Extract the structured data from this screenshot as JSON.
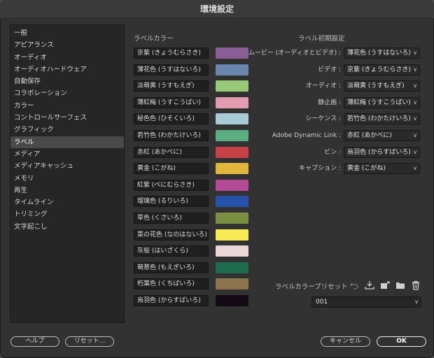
{
  "window": {
    "title": "環境設定"
  },
  "sidebar": {
    "items": [
      {
        "label": "一般"
      },
      {
        "label": "アピアランス"
      },
      {
        "label": "オーディオ"
      },
      {
        "label": "オーディオハードウェア"
      },
      {
        "label": "自動保存"
      },
      {
        "label": "コラボレーション"
      },
      {
        "label": "カラー"
      },
      {
        "label": "コントロールサーフェス"
      },
      {
        "label": "グラフィック"
      },
      {
        "label": "ラベル",
        "selected": true
      },
      {
        "label": "メディア"
      },
      {
        "label": "メディアキャッシュ"
      },
      {
        "label": "メモリ"
      },
      {
        "label": "再生"
      },
      {
        "label": "タイムライン"
      },
      {
        "label": "トリミング"
      },
      {
        "label": "文字起こし"
      }
    ]
  },
  "label_colors": {
    "title": "ラベルカラー",
    "items": [
      {
        "name": "京紫 (きょうむらさき)",
        "color": "#8a5f95"
      },
      {
        "name": "薄花色 (うすはないろ)",
        "color": "#6b86ad"
      },
      {
        "name": "淡萌黄 (うすもえぎ)",
        "color": "#98c979"
      },
      {
        "name": "薄紅梅 (うすこうばい)",
        "color": "#e39bb2"
      },
      {
        "name": "秘色色 (ひそくいろ)",
        "color": "#a9cbd7"
      },
      {
        "name": "若竹色 (わかたけいろ)",
        "color": "#5aae82"
      },
      {
        "name": "赤紅 (あかべに)",
        "color": "#c84148"
      },
      {
        "name": "黄金 (こがね)",
        "color": "#e2b53d"
      },
      {
        "name": "紅紫 (べにむらさき)",
        "color": "#b34b97"
      },
      {
        "name": "瑠璃色 (るりいろ)",
        "color": "#2752ac"
      },
      {
        "name": "草色 (くさいろ)",
        "color": "#7b8e42"
      },
      {
        "name": "菜の花色 (なのはないろ)",
        "color": "#f7ea55"
      },
      {
        "name": "灰桜 (はいざくら)",
        "color": "#ead6d6"
      },
      {
        "name": "萌葱色 (もえぎいろ)",
        "color": "#1f6b4d"
      },
      {
        "name": "朽葉色 (くちばいろ)",
        "color": "#8d744d"
      },
      {
        "name": "烏羽色 (からすばいろ)",
        "color": "#140a16"
      }
    ]
  },
  "label_defaults": {
    "title": "ラベル初期設定",
    "items": [
      {
        "label": "ムービー (オーディオとビデオ) :",
        "value": "薄花色 (うすはないろ)"
      },
      {
        "label": "ビデオ :",
        "value": "京紫 (きょうむらさき)"
      },
      {
        "label": "オーディオ :",
        "value": "淡萌黄 (うすもえぎ)"
      },
      {
        "label": "静止画 :",
        "value": "薄紅梅 (うすこうばい)"
      },
      {
        "label": "シーケンス :",
        "value": "若竹色 (わかたけいろ)"
      },
      {
        "label": "Adobe Dynamic Link :",
        "value": "赤紅 (あかべに)"
      },
      {
        "label": "ビン :",
        "value": "烏羽色 (からすばいろ)"
      },
      {
        "label": "キャプション :",
        "value": "黄金 (こがね)"
      }
    ]
  },
  "preset": {
    "label": "ラベルカラープリセット",
    "value": "001",
    "icons": [
      "undo-icon",
      "import-icon",
      "export-icon",
      "folder-icon",
      "trash-icon"
    ]
  },
  "buttons": {
    "help": "ヘルプ",
    "reset": "リセット...",
    "cancel": "キャンセル",
    "ok": "OK"
  }
}
